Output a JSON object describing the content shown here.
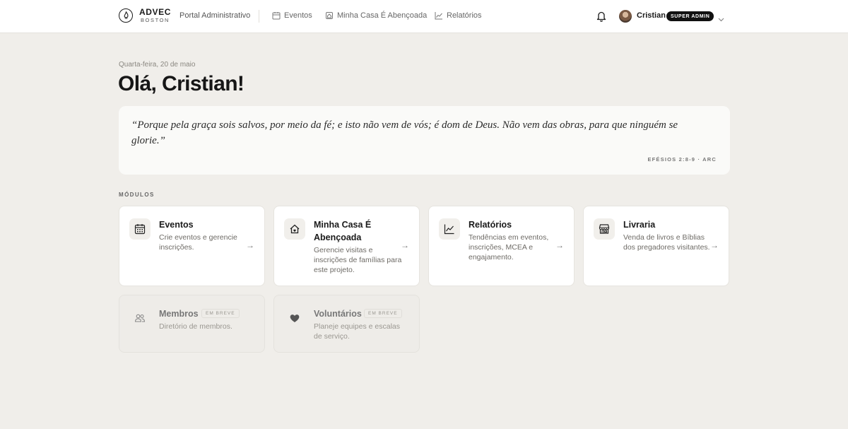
{
  "brand": {
    "name": "ADVEC",
    "sub": "BOSTON"
  },
  "portal_label": "Portal Administrativo",
  "nav": [
    {
      "label": "Eventos",
      "icon": "calendar-icon"
    },
    {
      "label": "Minha Casa É Abençoada",
      "icon": "home-icon"
    },
    {
      "label": "Relatórios",
      "icon": "chart-icon"
    }
  ],
  "user": {
    "name": "Cristian",
    "role": "SUPER ADMIN"
  },
  "header": {
    "date": "Quarta-feira, 20 de maio",
    "greeting": "Olá, Cristian!"
  },
  "verse": {
    "text": "“Porque pela graça sois salvos, por meio da fé; e isto não vem de vós; é dom de Deus. Não vem das obras, para que ninguém se glorie.”",
    "reference": "EFÉSIOS 2:8-9 · ARC"
  },
  "modules_label": "MÓDULOS",
  "modules": [
    {
      "title": "Eventos",
      "desc": "Crie eventos e gerencie inscrições.",
      "icon": "calendar-icon",
      "arrow": "→"
    },
    {
      "title": "Minha Casa É Abençoada",
      "desc": "Gerencie visitas e inscrições de famílias para este projeto.",
      "icon": "home-icon",
      "arrow": "→"
    },
    {
      "title": "Relatórios",
      "desc": "Tendências em eventos, inscrições, MCEA e engajamento.",
      "icon": "chart-icon",
      "arrow": "→"
    },
    {
      "title": "Livraria",
      "desc": "Venda de livros e Bíblias dos pregadores visitantes.",
      "icon": "store-icon",
      "arrow": "→"
    }
  ],
  "soon_modules": [
    {
      "title": "Membros",
      "desc": "Diretório de membros.",
      "badge": "EM BREVE",
      "icon": "users-icon"
    },
    {
      "title": "Voluntários",
      "desc": "Planeje equipes e escalas de serviço.",
      "badge": "EM BREVE",
      "icon": "heart-icon"
    }
  ]
}
